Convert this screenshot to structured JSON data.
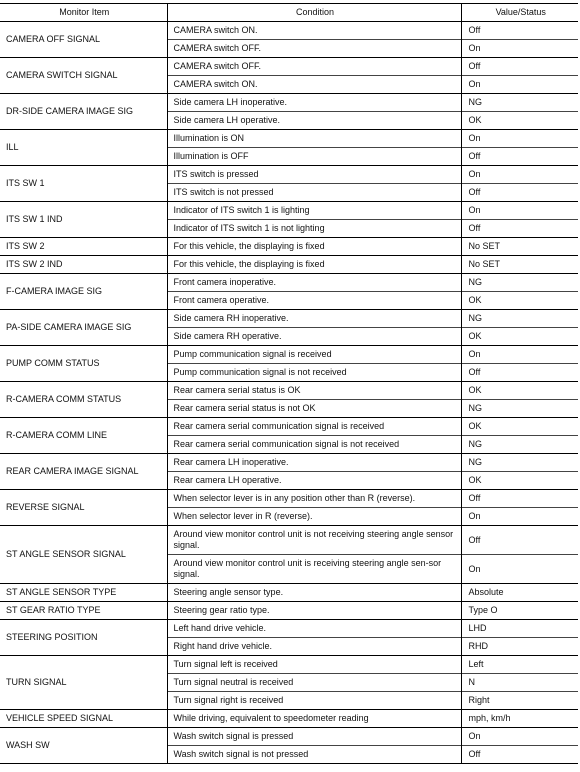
{
  "table": {
    "headers": {
      "item": "Monitor Item",
      "condition": "Condition",
      "value": "Value/Status"
    },
    "groups": [
      {
        "item": "CAMERA OFF SIGNAL",
        "rows": [
          {
            "condition": "CAMERA switch ON.",
            "value": "Off"
          },
          {
            "condition": "CAMERA switch OFF.",
            "value": "On"
          }
        ]
      },
      {
        "item": "CAMERA SWITCH SIGNAL",
        "rows": [
          {
            "condition": "CAMERA switch OFF.",
            "value": "Off"
          },
          {
            "condition": "CAMERA switch ON.",
            "value": "On"
          }
        ]
      },
      {
        "item": "DR-SIDE CAMERA IMAGE SIG",
        "rows": [
          {
            "condition": "Side camera LH inoperative.",
            "value": "NG"
          },
          {
            "condition": "Side camera LH operative.",
            "value": "OK"
          }
        ]
      },
      {
        "item": "ILL",
        "rows": [
          {
            "condition": "Illumination is ON",
            "value": "On"
          },
          {
            "condition": "Illumination is OFF",
            "value": "Off"
          }
        ]
      },
      {
        "item": "ITS SW 1",
        "rows": [
          {
            "condition": "ITS switch is pressed",
            "value": "On"
          },
          {
            "condition": "ITS switch is not pressed",
            "value": "Off"
          }
        ]
      },
      {
        "item": "ITS SW 1 IND",
        "rows": [
          {
            "condition": "Indicator of ITS switch 1 is lighting",
            "value": "On"
          },
          {
            "condition": "Indicator of ITS switch 1 is not lighting",
            "value": "Off"
          }
        ]
      },
      {
        "item": "ITS SW 2",
        "rows": [
          {
            "condition": "For this vehicle, the displaying is fixed",
            "value": "No SET"
          }
        ]
      },
      {
        "item": "ITS SW 2 IND",
        "rows": [
          {
            "condition": "For this vehicle, the displaying is fixed",
            "value": "No SET"
          }
        ]
      },
      {
        "item": "F-CAMERA IMAGE SIG",
        "rows": [
          {
            "condition": "Front camera inoperative.",
            "value": "NG"
          },
          {
            "condition": "Front camera operative.",
            "value": "OK"
          }
        ]
      },
      {
        "item": "PA-SIDE CAMERA IMAGE SIG",
        "rows": [
          {
            "condition": "Side camera RH inoperative.",
            "value": "NG"
          },
          {
            "condition": "Side camera RH operative.",
            "value": "OK"
          }
        ]
      },
      {
        "item": "PUMP COMM STATUS",
        "rows": [
          {
            "condition": "Pump communication signal is received",
            "value": "On"
          },
          {
            "condition": "Pump communication signal is not received",
            "value": "Off"
          }
        ]
      },
      {
        "item": "R-CAMERA COMM STATUS",
        "rows": [
          {
            "condition": "Rear camera serial status is OK",
            "value": "OK"
          },
          {
            "condition": "Rear camera serial status is not OK",
            "value": "NG"
          }
        ]
      },
      {
        "item": "R-CAMERA COMM LINE",
        "rows": [
          {
            "condition": "Rear camera serial communication signal is received",
            "value": "OK"
          },
          {
            "condition": "Rear camera serial communication signal is not received",
            "value": "NG"
          }
        ]
      },
      {
        "item": "REAR CAMERA IMAGE SIGNAL",
        "rows": [
          {
            "condition": "Rear camera LH inoperative.",
            "value": "NG"
          },
          {
            "condition": "Rear camera LH operative.",
            "value": "OK"
          }
        ]
      },
      {
        "item": "REVERSE SIGNAL",
        "rows": [
          {
            "condition": "When selector lever is in any position other than R (reverse).",
            "value": "Off"
          },
          {
            "condition": "When selector lever in R (reverse).",
            "value": "On"
          }
        ]
      },
      {
        "item": "ST ANGLE SENSOR SIGNAL",
        "tall": true,
        "rows": [
          {
            "condition": "Around view monitor control unit is not receiving steering angle sensor signal.",
            "value": "Off"
          },
          {
            "condition": "Around view monitor control unit is receiving steering angle sen-sor signal.",
            "value": "On"
          }
        ]
      },
      {
        "item": "ST ANGLE SENSOR TYPE",
        "rows": [
          {
            "condition": "Steering angle sensor type.",
            "value": "Absolute"
          }
        ]
      },
      {
        "item": "ST GEAR RATIO TYPE",
        "rows": [
          {
            "condition": "Steering gear ratio type.",
            "value": "Type O"
          }
        ]
      },
      {
        "item": "STEERING POSITION",
        "rows": [
          {
            "condition": "Left hand drive vehicle.",
            "value": "LHD"
          },
          {
            "condition": "Right hand drive vehicle.",
            "value": "RHD"
          }
        ]
      },
      {
        "item": "TURN SIGNAL",
        "rows": [
          {
            "condition": "Turn signal left is received",
            "value": "Left"
          },
          {
            "condition": "Turn signal neutral is received",
            "value": "N"
          },
          {
            "condition": "Turn signal right is received",
            "value": "Right"
          }
        ]
      },
      {
        "item": "VEHICLE SPEED SIGNAL",
        "rows": [
          {
            "condition": "While driving, equivalent to speedometer reading",
            "value": "mph, km/h"
          }
        ]
      },
      {
        "item": "WASH SW",
        "rows": [
          {
            "condition": "Wash switch signal is pressed",
            "value": "On"
          },
          {
            "condition": "Wash switch signal is not pressed",
            "value": "Off"
          }
        ]
      }
    ]
  }
}
